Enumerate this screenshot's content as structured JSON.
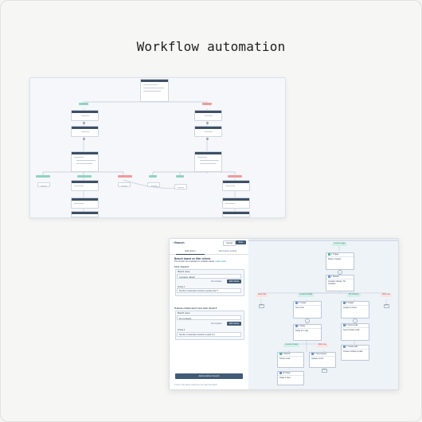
{
  "page": {
    "title": "Workflow automation"
  },
  "editor": {
    "panel_title": "Branch",
    "cancel_label": "Cancel",
    "save_label": "Save",
    "tabs": [
      "Edit action",
      "Set branch sorting"
    ],
    "heading": "Branch based on filter criteria",
    "subheading": "The branch are evaluated in multiple values.",
    "learn_more": "Learn more",
    "first_check": "First, check if",
    "branch1": {
      "name_label": "Branch name",
      "name_value": "Contacts (Ideal)",
      "set_compare": "Set compare",
      "edit_criteria": "Edit criteria",
      "group_label": "Group 1",
      "group_value": "Number of associated contacts is greater than 5"
    },
    "then_check": "If above criteria aren't met, then check if",
    "branch2": {
      "name_label": "Branch name",
      "name_value": "No Contacts",
      "set_compare": "Set compare",
      "edit_criteria": "Edit criteria",
      "group_label": "Group 1",
      "group_value": "Number of associated contacts is equal to 0"
    },
    "add_branch": "Add another branch",
    "footer_note": "If none of the above criteria are met, take this branch"
  },
  "flow": {
    "top_label": "Contact trigger",
    "trigger_card": {
      "title": "1. Trigger",
      "body": "Deal is created"
    },
    "branch_card": {
      "title": "2. Branch",
      "body": "Contacts (Ideal) / No Contacts"
    },
    "branch_labels": [
      "None met",
      "Contacts (Ideal)",
      "No Contacts",
      "None met"
    ],
    "cards": [
      {
        "title": "3. Create",
        "body": "Set a note"
      },
      {
        "title": "4. Delay",
        "body": "Delay for 1 day"
      },
      {
        "title": "5. Assign",
        "body": "Assign to owner"
      },
      {
        "title": "6. Send email",
        "body": "Send contact email"
      },
      {
        "title": "7. Create task",
        "body": "Create a follow-up task"
      },
      {
        "title": "8. Branch",
        "body": "Check result"
      },
      {
        "title": "9. Set property",
        "body": "Update record"
      },
      {
        "title": "10. Delay",
        "body": "Delay 2 days"
      },
      {
        "title": "11. Email",
        "body": "Send internal email"
      }
    ],
    "end_label": "END"
  },
  "colors": {
    "accent": "#425b76",
    "success_badge": "#8fd3c0",
    "error_badge": "#ef9a9a",
    "canvas_bg": "#eef3f8"
  }
}
